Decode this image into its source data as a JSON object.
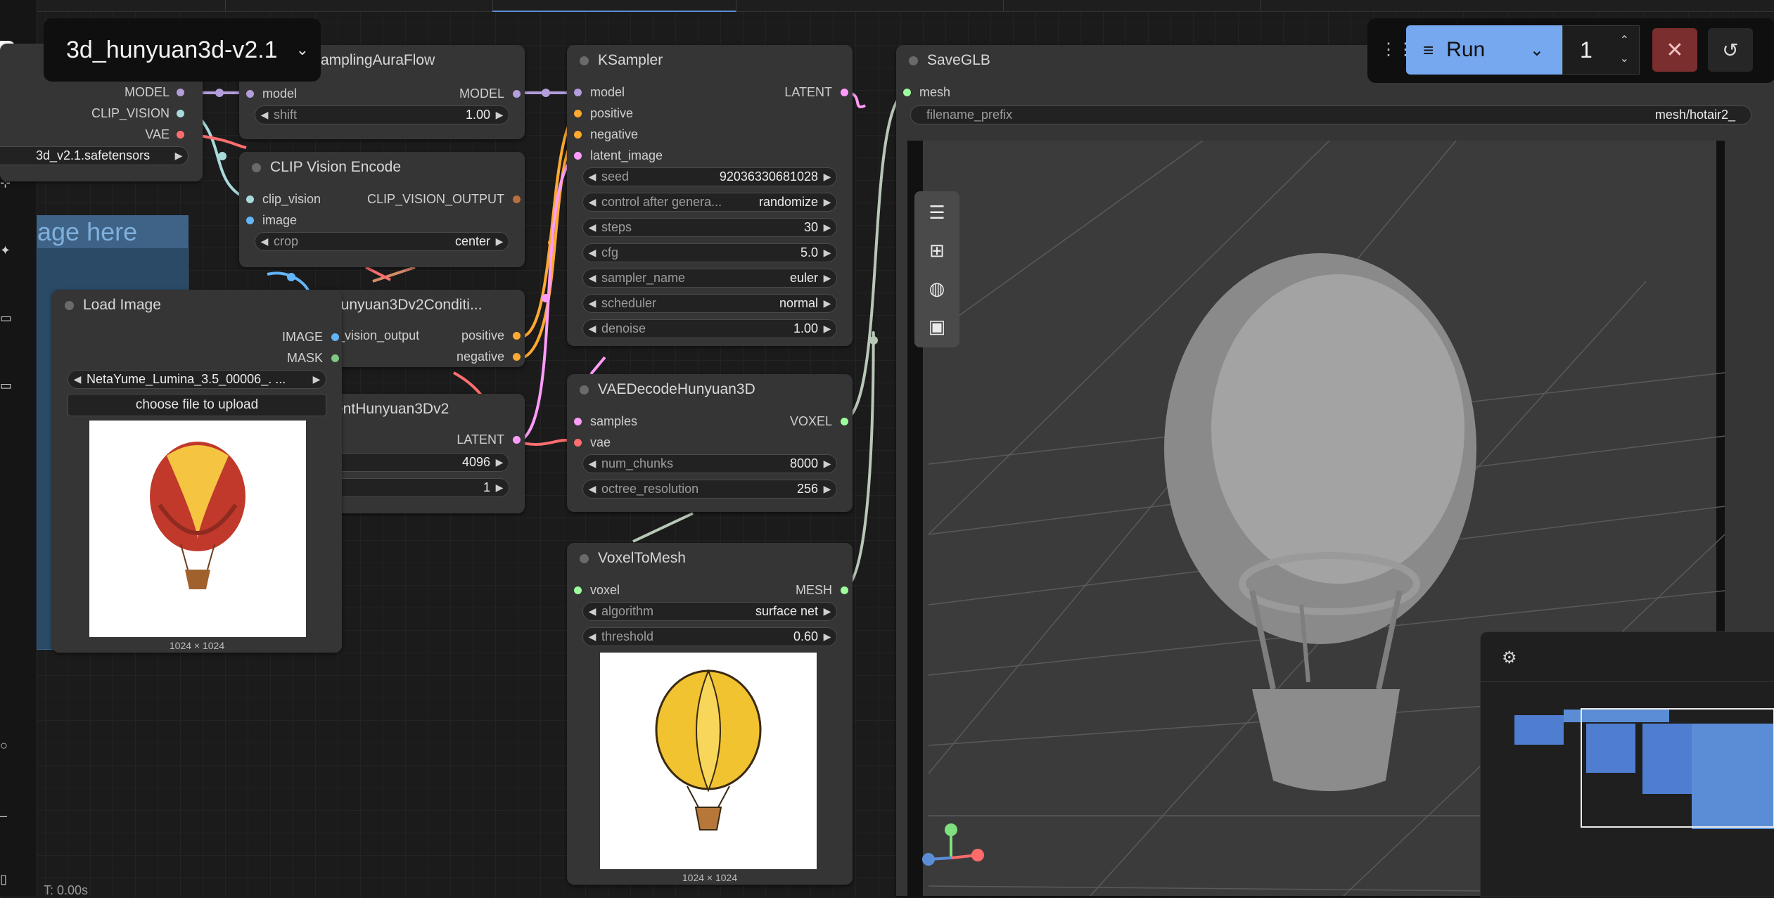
{
  "workflow": {
    "title": "3d_hunyuan3d-v2.1"
  },
  "toolbar": {
    "run_label": "Run",
    "queue_count": "1"
  },
  "status": {
    "timer": "T: 0.00s"
  },
  "nodes": {
    "checkpoint": {
      "outputs": [
        "MODEL",
        "CLIP_VISION",
        "VAE"
      ],
      "ckpt_value": "3d_v2.1.safetensors"
    },
    "note": {
      "text": "age here"
    },
    "model_sampling": {
      "title": "amplingAuraFlow",
      "input": "model",
      "output": "MODEL",
      "shift_label": "shift",
      "shift_value": "1.00"
    },
    "clip_vision_encode": {
      "title": "CLIP Vision Encode",
      "inputs": [
        "clip_vision",
        "image"
      ],
      "output": "CLIP_VISION_OUTPUT",
      "crop_label": "crop",
      "crop_value": "center"
    },
    "load_image": {
      "title": "Load Image",
      "outputs": [
        "IMAGE",
        "MASK"
      ],
      "image_value": "NetaYume_Lumina_3.5_00006_. ...",
      "upload_label": "choose file to upload",
      "dims": "1024 × 1024"
    },
    "hunyuan_cond": {
      "title": "lunyuan3Dv2Conditi...",
      "input": "_vision_output",
      "outputs": [
        "positive",
        "negative"
      ]
    },
    "empty_latent": {
      "title": "entHunyuan3Dv2",
      "output": "LATENT",
      "res_value": "4096",
      "batch_value": "1"
    },
    "ksampler": {
      "title": "KSampler",
      "inputs": [
        "model",
        "positive",
        "negative",
        "latent_image"
      ],
      "output": "LATENT",
      "widgets": [
        {
          "label": "seed",
          "value": "92036330681028"
        },
        {
          "label": "control after genera...",
          "value": "randomize"
        },
        {
          "label": "steps",
          "value": "30"
        },
        {
          "label": "cfg",
          "value": "5.0"
        },
        {
          "label": "sampler_name",
          "value": "euler"
        },
        {
          "label": "scheduler",
          "value": "normal"
        },
        {
          "label": "denoise",
          "value": "1.00"
        }
      ]
    },
    "vae_decode": {
      "title": "VAEDecodeHunyuan3D",
      "inputs": [
        "samples",
        "vae"
      ],
      "output": "VOXEL",
      "widgets": [
        {
          "label": "num_chunks",
          "value": "8000"
        },
        {
          "label": "octree_resolution",
          "value": "256"
        }
      ]
    },
    "voxel_to_mesh": {
      "title": "VoxelToMesh",
      "input": "voxel",
      "output": "MESH",
      "widgets": [
        {
          "label": "algorithm",
          "value": "surface net"
        },
        {
          "label": "threshold",
          "value": "0.60"
        }
      ],
      "dims": "1024 × 1024"
    },
    "save_glb": {
      "title": "SaveGLB",
      "input": "mesh",
      "prefix_label": "filename_prefix",
      "prefix_value": "mesh/hotair2_"
    }
  },
  "colors": {
    "model": "#b39ddb",
    "clip_vision": "#a8dadc",
    "vae": "#ff6e6e",
    "image": "#64b5f6",
    "mask": "#81c784",
    "conditioning": "#ffa931",
    "latent": "#ff9cf9",
    "voxel_mesh": "#9cff9c",
    "run_button": "#76a8f0"
  }
}
